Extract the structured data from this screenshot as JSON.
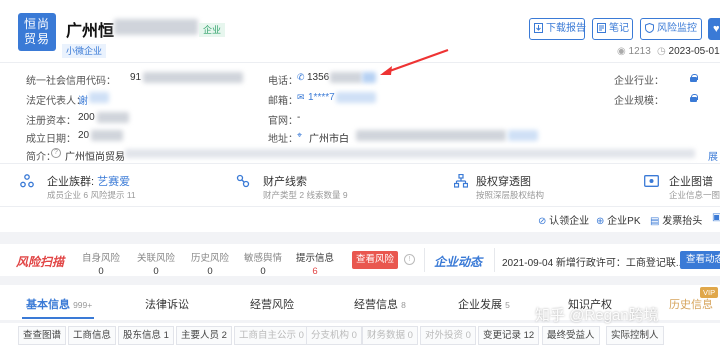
{
  "company": {
    "logo_text": "恒尚贸易",
    "name_prefix": "广州恒",
    "tag_status": "企业",
    "tag_size": "小微企业"
  },
  "actions": {
    "download": "下载报告",
    "note": "笔记",
    "risk": "风险监控"
  },
  "meta": {
    "views": "1213",
    "date": "2023-05-01"
  },
  "info": {
    "credit_code_label": "统一社会信用代码：",
    "credit_code_val": "91",
    "legal_label": "法定代表人：",
    "legal_val": "谢",
    "capital_label": "注册资本：",
    "capital_val": "200",
    "founded_label": "成立日期：",
    "founded_val": "20",
    "intro_label": "简介：",
    "intro_val": "广州恒尚贸易",
    "phone_label": "电话：",
    "phone_val": "1356",
    "email_label": "邮箱：",
    "email_val": "1****7",
    "site_label": "官网：",
    "site_val": "-",
    "addr_label": "地址：",
    "addr_val": "广州市白",
    "industry_label": "企业行业：",
    "scale_label": "企业规模：",
    "more": "展"
  },
  "features": [
    {
      "title": "企业族群:",
      "title_link": "艺赛爱",
      "sub": "成员企业 6  风险提示 11"
    },
    {
      "title": "财产线索",
      "sub": "财产类型 2  线索数量 9"
    },
    {
      "title": "股权穿透图",
      "sub": "按照深层股权结构"
    },
    {
      "title": "企业图谱",
      "sub": "企业信息一图掌"
    }
  ],
  "links": {
    "claim": "认领企业",
    "pk": "企业PK",
    "invoice": "发票抬头"
  },
  "risk_bar": {
    "logo": "风险扫描",
    "items": [
      {
        "label": "自身风险",
        "count": "0"
      },
      {
        "label": "关联风险",
        "count": "0"
      },
      {
        "label": "历史风险",
        "count": "0"
      },
      {
        "label": "敏感舆情",
        "count": "0"
      },
      {
        "label": "提示信息",
        "count": "6"
      }
    ],
    "check_btn": "查看风险",
    "dynamic_logo": "企业动态",
    "news": "2021-09-04 新增行政许可：工商登记联...",
    "dynamic_btn": "查看动态"
  },
  "main_tabs": [
    {
      "label": "基本信息",
      "count": "999+"
    },
    {
      "label": "法律诉讼",
      "count": ""
    },
    {
      "label": "经营风险",
      "count": ""
    },
    {
      "label": "经营信息",
      "count": "8"
    },
    {
      "label": "企业发展",
      "count": "5"
    },
    {
      "label": "知识产权",
      "count": ""
    },
    {
      "label": "历史信息",
      "count": ""
    }
  ],
  "sub_tabs": [
    {
      "label": "查查图谱"
    },
    {
      "label": "工商信息"
    },
    {
      "label": "股东信息 1"
    },
    {
      "label": "主要人员 2"
    },
    {
      "label": "工商自主公示 0"
    },
    {
      "label": "分支机构 0"
    },
    {
      "label": "财务数据 0"
    },
    {
      "label": "对外投资 0"
    },
    {
      "label": "变更记录 12"
    },
    {
      "label": "最终受益人"
    },
    {
      "label": "实际控制人"
    }
  ],
  "watermark": "知乎 @Regan跨境",
  "vip": "VIP"
}
